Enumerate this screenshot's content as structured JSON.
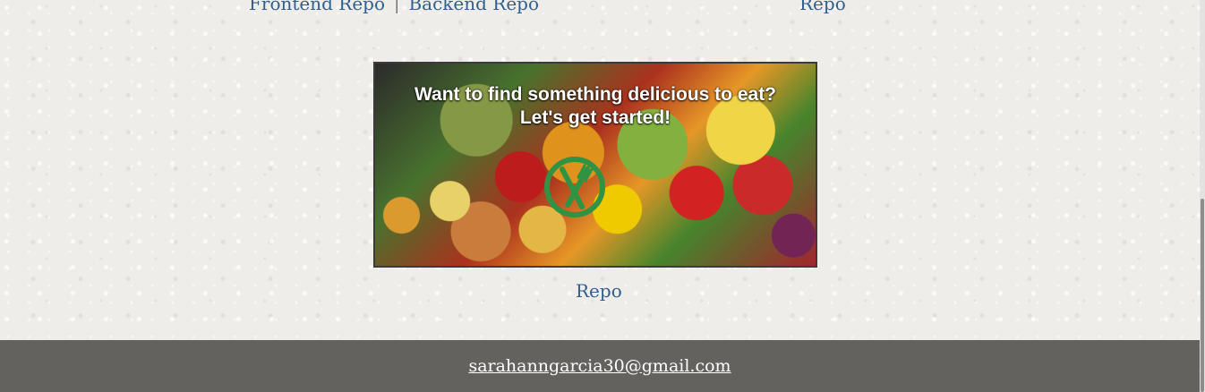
{
  "top_links": {
    "left_frontend": "Frontend Repo",
    "left_backend": "Backend Repo",
    "separator": "|",
    "right": "Repo"
  },
  "project": {
    "banner_line1": "Want to find something delicious to eat?",
    "banner_line2": "Let's get started!",
    "logo_icon": "fork-knife-icon",
    "repo_link": "Repo"
  },
  "footer": {
    "email": "sarahanngarcia30@gmail.com"
  },
  "colors": {
    "link": "#2f5f8d",
    "footer_bg": "#64625f",
    "footer_text": "#ffffff",
    "logo_green": "#2f9343"
  }
}
